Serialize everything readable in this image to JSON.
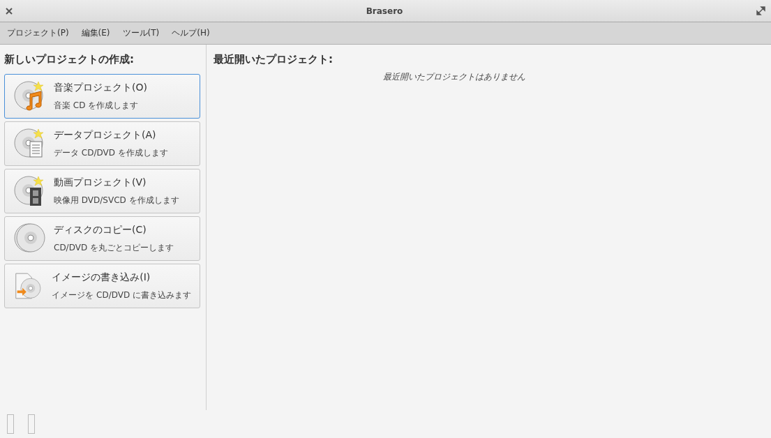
{
  "window": {
    "title": "Brasero"
  },
  "menu": [
    "プロジェクト(P)",
    "編集(E)",
    "ツール(T)",
    "ヘルプ(H)"
  ],
  "new_project": {
    "heading": "新しいプロジェクトの作成:",
    "items": [
      {
        "kind": "audio",
        "title": "音楽プロジェクト(O)",
        "subtitle": "音楽 CD を作成します",
        "selected": true
      },
      {
        "kind": "data",
        "title": "データプロジェクト(A)",
        "subtitle": "データ CD/DVD を作成します",
        "selected": false
      },
      {
        "kind": "video",
        "title": "動画プロジェクト(V)",
        "subtitle": "映像用 DVD/SVCD を作成します",
        "selected": false
      },
      {
        "kind": "copy",
        "title": "ディスクのコピー(C)",
        "subtitle": "CD/DVD を丸ごとコピーします",
        "selected": false
      },
      {
        "kind": "image",
        "title": "イメージの書き込み(I)",
        "subtitle": "イメージを CD/DVD に書き込みます",
        "selected": false
      }
    ]
  },
  "recent": {
    "heading": "最近開いたプロジェクト:",
    "empty_text": "最近開いたプロジェクトはありません"
  }
}
